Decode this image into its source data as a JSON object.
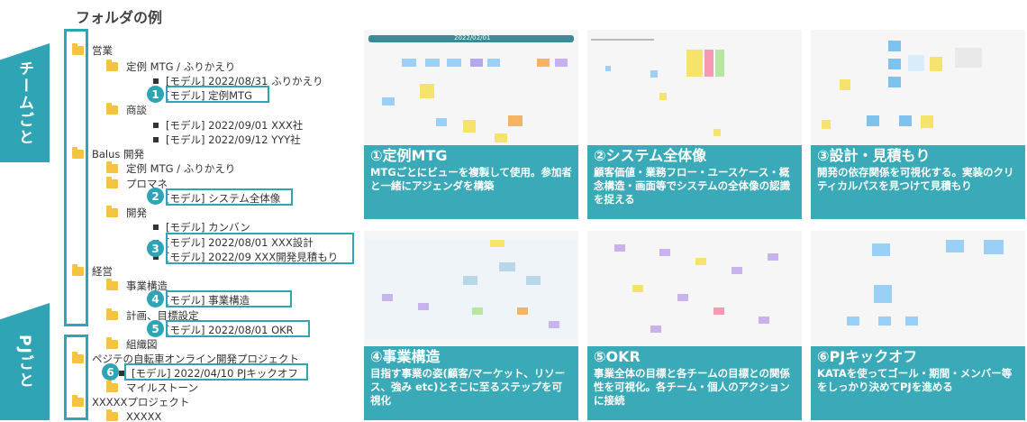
{
  "page": {
    "title": "フォルダの例"
  },
  "side_labels": {
    "team": "チームごと",
    "pj": "PJごと"
  },
  "tree": [
    "営業",
    "定例 MTG / ふりかえり",
    "[モデル] 2022/08/31 ふりかえり",
    "[モデル] 定例MTG",
    "商談",
    "[モデル] 2022/09/01 XXX社",
    "[モデル] 2022/09/12 YYY社",
    "Balus 開発",
    "定例 MTG / ふりかえり",
    "プロマネ",
    "[モデル] システム全体像",
    "開発",
    "[モデル] カンバン",
    "[モデル] 2022/08/01 XXX設計",
    "[モデル] 2022/09 XXX開発見積もり",
    "経営",
    "事業構造",
    "[モデル] 事業構造",
    "計画、目標設定",
    "[モデル] 2022/08/01 OKR",
    "組織図",
    "ペジテの自転車オンライン開発プロジェクト",
    "[モデル] 2022/04/10 PJキックオフ",
    "マイルストーン",
    "XXXXXプロジェクト",
    "XXXXX"
  ],
  "markers": [
    "1",
    "2",
    "3",
    "4",
    "5",
    "6"
  ],
  "cards": [
    {
      "title": "①定例MTG",
      "desc": "MTGごとにビューを複製して使用。参加者と一緒にアジェンダを構築",
      "screen_title": "2022/02/01"
    },
    {
      "title": "②システム全体像",
      "desc": "顧客価値・業務フロー・ユースケース・概念構造・画面等でシステムの全体像の認識を捉える"
    },
    {
      "title": "③設計・見積もり",
      "desc": "開発の依存関係を可視化する。実装のクリティカルパスを見つけて見積もり"
    },
    {
      "title": "④事業構造",
      "desc": "目指す事業の姿(顧客/マーケット、リソース、強み etc)とそこに至るステップを可視化"
    },
    {
      "title": "⑤OKR",
      "desc": "事業全体の目標と各チームの目標との関係性を可視化。各チーム・個人のアクションに接続"
    },
    {
      "title": "⑥PJキックオフ",
      "desc": "KATAを使ってゴール・期間・メンバー等をしっかり決めてPJを進める"
    }
  ],
  "colors": {
    "accent": "#2fa4b4",
    "caption_bg": "#3aa9b8",
    "folder": "#f5c342"
  }
}
